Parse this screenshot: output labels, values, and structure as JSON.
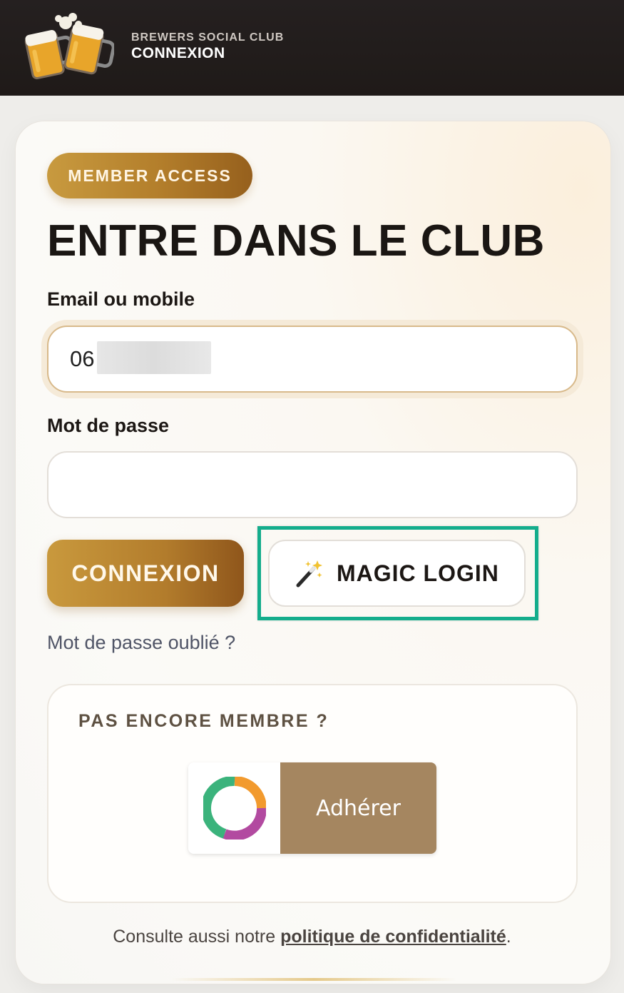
{
  "header": {
    "club_name": "BREWERS SOCIAL CLUB",
    "page_name": "CONNEXION",
    "logo_icon": "beer-mugs-icon"
  },
  "login": {
    "badge": "MEMBER ACCESS",
    "title": "ENTRE DANS LE CLUB",
    "email_label": "Email ou mobile",
    "email_value": "06",
    "password_label": "Mot de passe",
    "password_value": "",
    "connexion_button": "CONNEXION",
    "magic_login_button": "MAGIC LOGIN",
    "magic_icon": "magic-wand-icon",
    "forgot_password": "Mot de passe oublié ?"
  },
  "signup": {
    "title": "PAS ENCORE MEMBRE ?",
    "join_button": "Adhérer",
    "join_logo": "helloasso-logo-icon"
  },
  "footer": {
    "prefix": "Consulte aussi notre ",
    "link": "politique de confidentialité",
    "suffix": "."
  },
  "colors": {
    "header_bg": "#231e1c",
    "gold_accent": "#b37e2b",
    "highlight": "#14ad8c",
    "join_bg": "#a58660"
  }
}
